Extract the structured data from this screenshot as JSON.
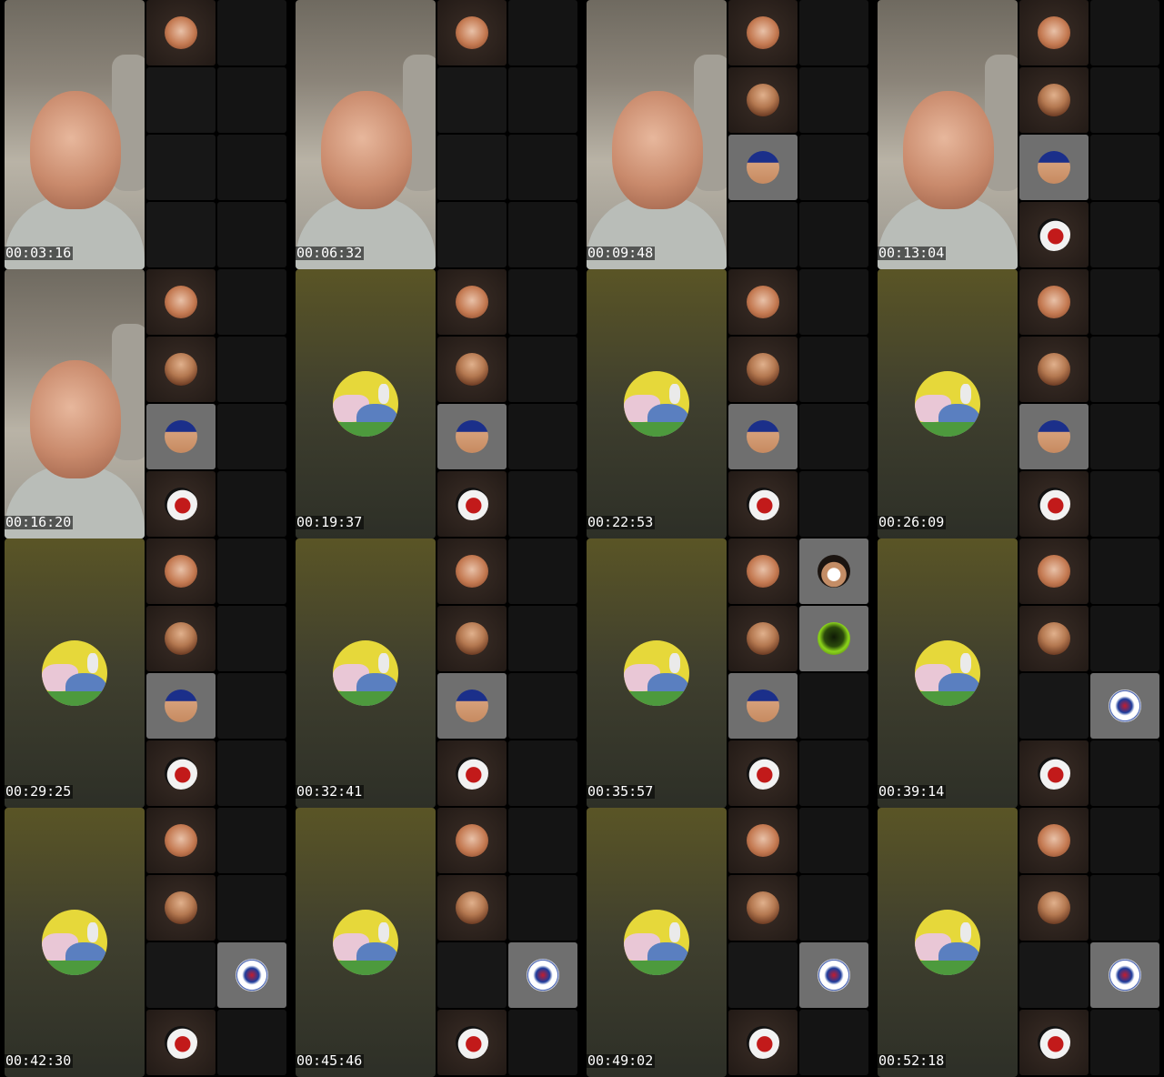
{
  "frames": [
    {
      "timestamp": "00:03:16",
      "main": "video",
      "tiles": [
        {
          "icon": "redhead-avatar-icon"
        },
        {
          "icon": ""
        },
        {
          "icon": ""
        },
        {
          "icon": ""
        },
        {
          "icon": ""
        },
        {
          "icon": ""
        },
        {
          "icon": ""
        },
        {
          "icon": ""
        }
      ]
    },
    {
      "timestamp": "00:06:32",
      "main": "video",
      "tiles": [
        {
          "icon": "redhead-avatar-icon"
        },
        {
          "icon": ""
        },
        {
          "icon": ""
        },
        {
          "icon": ""
        },
        {
          "icon": ""
        },
        {
          "icon": ""
        },
        {
          "icon": ""
        },
        {
          "icon": ""
        }
      ]
    },
    {
      "timestamp": "00:09:48",
      "main": "video",
      "tiles": [
        {
          "icon": "redhead-avatar-icon"
        },
        {
          "icon": ""
        },
        {
          "icon": "bearded-man-avatar-icon"
        },
        {
          "icon": ""
        },
        {
          "icon": "blue-hair-avatar-icon",
          "highlight": true
        },
        {
          "icon": ""
        },
        {
          "icon": ""
        },
        {
          "icon": ""
        }
      ]
    },
    {
      "timestamp": "00:13:04",
      "main": "video",
      "tiles": [
        {
          "icon": "redhead-avatar-icon"
        },
        {
          "icon": ""
        },
        {
          "icon": "bearded-man-avatar-icon"
        },
        {
          "icon": ""
        },
        {
          "icon": "blue-hair-avatar-icon",
          "highlight": true
        },
        {
          "icon": ""
        },
        {
          "icon": "clown-avatar-icon"
        },
        {
          "icon": ""
        }
      ]
    },
    {
      "timestamp": "00:16:20",
      "main": "video",
      "tiles": [
        {
          "icon": "redhead-avatar-icon"
        },
        {
          "icon": ""
        },
        {
          "icon": "bearded-man-avatar-icon"
        },
        {
          "icon": ""
        },
        {
          "icon": "blue-hair-avatar-icon",
          "highlight": true
        },
        {
          "icon": ""
        },
        {
          "icon": "clown-avatar-icon"
        },
        {
          "icon": ""
        }
      ]
    },
    {
      "timestamp": "00:19:37",
      "main": "cartoon",
      "tiles": [
        {
          "icon": "redhead-avatar-icon"
        },
        {
          "icon": ""
        },
        {
          "icon": "bearded-man-avatar-icon"
        },
        {
          "icon": ""
        },
        {
          "icon": "blue-hair-avatar-icon",
          "highlight": true
        },
        {
          "icon": ""
        },
        {
          "icon": "clown-avatar-icon"
        },
        {
          "icon": ""
        }
      ]
    },
    {
      "timestamp": "00:22:53",
      "main": "cartoon",
      "tiles": [
        {
          "icon": "redhead-avatar-icon"
        },
        {
          "icon": ""
        },
        {
          "icon": "bearded-man-avatar-icon"
        },
        {
          "icon": ""
        },
        {
          "icon": "blue-hair-avatar-icon",
          "highlight": true
        },
        {
          "icon": ""
        },
        {
          "icon": "clown-avatar-icon"
        },
        {
          "icon": ""
        }
      ]
    },
    {
      "timestamp": "00:26:09",
      "main": "cartoon",
      "tiles": [
        {
          "icon": "redhead-avatar-icon"
        },
        {
          "icon": ""
        },
        {
          "icon": "bearded-man-avatar-icon"
        },
        {
          "icon": ""
        },
        {
          "icon": "blue-hair-avatar-icon",
          "highlight": true
        },
        {
          "icon": ""
        },
        {
          "icon": "clown-avatar-icon"
        },
        {
          "icon": ""
        }
      ]
    },
    {
      "timestamp": "00:29:25",
      "main": "cartoon",
      "tiles": [
        {
          "icon": "redhead-avatar-icon"
        },
        {
          "icon": ""
        },
        {
          "icon": "bearded-man-avatar-icon"
        },
        {
          "icon": ""
        },
        {
          "icon": "blue-hair-avatar-icon",
          "highlight": true
        },
        {
          "icon": ""
        },
        {
          "icon": "clown-avatar-icon"
        },
        {
          "icon": ""
        }
      ]
    },
    {
      "timestamp": "00:32:41",
      "main": "cartoon",
      "tiles": [
        {
          "icon": "redhead-avatar-icon"
        },
        {
          "icon": ""
        },
        {
          "icon": "bearded-man-avatar-icon"
        },
        {
          "icon": ""
        },
        {
          "icon": "blue-hair-avatar-icon",
          "highlight": true
        },
        {
          "icon": ""
        },
        {
          "icon": "clown-avatar-icon"
        },
        {
          "icon": ""
        }
      ]
    },
    {
      "timestamp": "00:35:57",
      "main": "cartoon",
      "tiles": [
        {
          "icon": "redhead-avatar-icon"
        },
        {
          "icon": "curly-hair-avatar-icon",
          "highlight": true
        },
        {
          "icon": "bearded-man-avatar-icon"
        },
        {
          "icon": "green-helmet-avatar-icon",
          "highlight": true
        },
        {
          "icon": "blue-hair-avatar-icon",
          "highlight": true
        },
        {
          "icon": ""
        },
        {
          "icon": "clown-avatar-icon"
        },
        {
          "icon": ""
        }
      ]
    },
    {
      "timestamp": "00:39:14",
      "main": "cartoon",
      "tiles": [
        {
          "icon": "redhead-avatar-icon"
        },
        {
          "icon": ""
        },
        {
          "icon": "bearded-man-avatar-icon"
        },
        {
          "icon": ""
        },
        {
          "icon": ""
        },
        {
          "icon": "club-crest-avatar-icon",
          "highlight": true
        },
        {
          "icon": "clown-avatar-icon"
        },
        {
          "icon": ""
        }
      ]
    },
    {
      "timestamp": "00:42:30",
      "main": "cartoon",
      "tiles": [
        {
          "icon": "redhead-avatar-icon"
        },
        {
          "icon": ""
        },
        {
          "icon": "bearded-man-avatar-icon"
        },
        {
          "icon": ""
        },
        {
          "icon": ""
        },
        {
          "icon": "club-crest-avatar-icon",
          "highlight": true
        },
        {
          "icon": "clown-avatar-icon"
        },
        {
          "icon": ""
        }
      ]
    },
    {
      "timestamp": "00:45:46",
      "main": "cartoon",
      "tiles": [
        {
          "icon": "redhead-avatar-icon"
        },
        {
          "icon": ""
        },
        {
          "icon": "bearded-man-avatar-icon"
        },
        {
          "icon": ""
        },
        {
          "icon": ""
        },
        {
          "icon": "club-crest-avatar-icon",
          "highlight": true
        },
        {
          "icon": "clown-avatar-icon"
        },
        {
          "icon": ""
        }
      ]
    },
    {
      "timestamp": "00:49:02",
      "main": "cartoon",
      "tiles": [
        {
          "icon": "redhead-avatar-icon"
        },
        {
          "icon": ""
        },
        {
          "icon": "bearded-man-avatar-icon"
        },
        {
          "icon": ""
        },
        {
          "icon": ""
        },
        {
          "icon": "club-crest-avatar-icon",
          "highlight": true
        },
        {
          "icon": "clown-avatar-icon"
        },
        {
          "icon": ""
        }
      ]
    },
    {
      "timestamp": "00:52:18",
      "main": "cartoon",
      "tiles": [
        {
          "icon": "redhead-avatar-icon"
        },
        {
          "icon": ""
        },
        {
          "icon": "bearded-man-avatar-icon"
        },
        {
          "icon": ""
        },
        {
          "icon": ""
        },
        {
          "icon": "club-crest-avatar-icon",
          "highlight": true
        },
        {
          "icon": "clown-avatar-icon"
        },
        {
          "icon": ""
        }
      ]
    }
  ]
}
